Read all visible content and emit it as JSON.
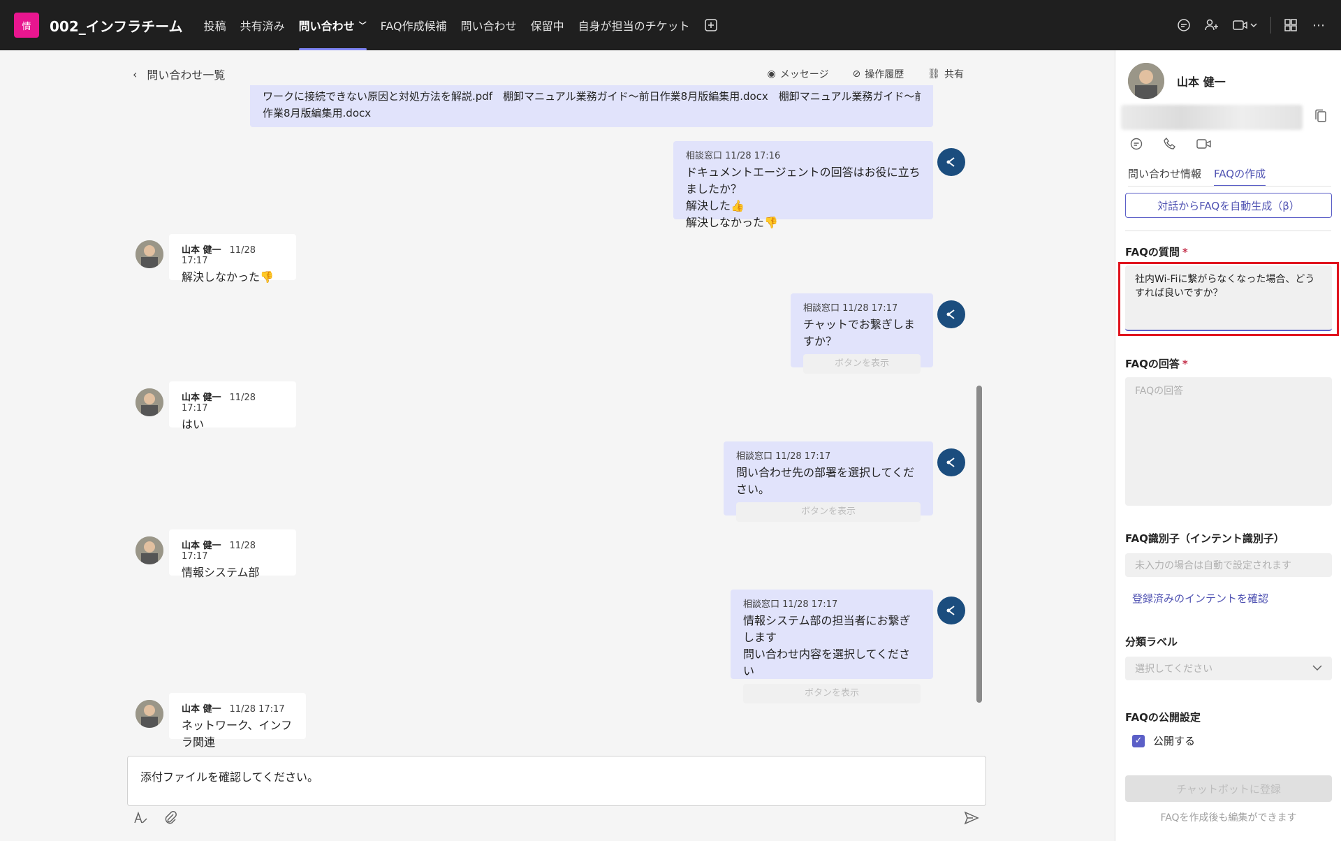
{
  "topbar": {
    "team_icon": "情",
    "team_name": "002_インフラチーム",
    "tabs": [
      {
        "label": "投稿"
      },
      {
        "label": "共有済み"
      },
      {
        "label": "問い合わせ"
      },
      {
        "label": "FAQ作成候補"
      },
      {
        "label": "問い合わせ"
      },
      {
        "label": "保留中"
      },
      {
        "label": "自身が担当のチケット"
      }
    ],
    "active_tab_index": 2,
    "right_icons": [
      "chat-icon",
      "people-add-icon",
      "video-icon",
      "apps-icon",
      "more-icon"
    ]
  },
  "chat": {
    "back_label": "問い合わせ一覧",
    "actions": {
      "message": "メッセージ",
      "history": "操作履歴",
      "share": "共有"
    },
    "attachment_text_1": "ワークに接続できない原因と対処方法を解説.pdf　棚卸マニュアル業務ガイド～前日作業8月版編集用.docx　棚卸マニュアル業務ガイド～前日",
    "attachment_text_2": "作業8月版編集用.docx",
    "messages": [
      {
        "sender": "相談窓口",
        "time": "11/28 17:16",
        "lines": [
          "ドキュメントエージェントの回答はお役に立ちましたか？",
          "解決した👍",
          "解決しなかった👎"
        ]
      },
      {
        "sender": "山本 健一",
        "time": "11/28 17:17",
        "lines": [
          "解決しなかった👎"
        ]
      },
      {
        "sender": "相談窓口",
        "time": "11/28 17:17",
        "lines": [
          "チャットでお繋ぎしますか？"
        ],
        "button": "ボタンを表示"
      },
      {
        "sender": "山本 健一",
        "time": "11/28 17:17",
        "lines": [
          "はい"
        ]
      },
      {
        "sender": "相談窓口",
        "time": "11/28 17:17",
        "lines": [
          "問い合わせ先の部署を選択してください。"
        ],
        "button": "ボタンを表示"
      },
      {
        "sender": "山本 健一",
        "time": "11/28 17:17",
        "lines": [
          "情報システム部"
        ]
      },
      {
        "sender": "相談窓口",
        "time": "11/28 17:17",
        "lines": [
          "情報システム部の担当者にお繋ぎします",
          "問い合わせ内容を選択してください"
        ],
        "button": "ボタンを表示"
      },
      {
        "sender": "山本 健一",
        "time": "11/28 17:17",
        "lines": [
          "ネットワーク、インフラ関連"
        ]
      }
    ],
    "compose_text": "添付ファイルを確認してください。"
  },
  "panel": {
    "user_name": "山本 健一",
    "tabs": [
      "問い合わせ情報",
      "FAQの作成"
    ],
    "active_tab_index": 1,
    "auto_generate_label": "対話からFAQを自動生成（β）",
    "faq_question_label": "FAQの質問",
    "faq_question_value": "社内Wi-Fiに繋がらなくなった場合、どうすれば良いですか？",
    "faq_answer_label": "FAQの回答",
    "faq_answer_placeholder": "FAQの回答",
    "intent_label": "FAQ識別子（インテント識別子）",
    "intent_placeholder": "未入力の場合は自動で設定されます",
    "intent_link": "登録済みのインテントを確認",
    "category_label": "分類ラベル",
    "category_placeholder": "選択してください",
    "publish_label": "FAQの公開設定",
    "publish_checkbox_label": "公開する",
    "register_button": "チャットボットに登録",
    "footnote": "FAQを作成後も編集ができます",
    "required_mark": "*"
  },
  "colors": {
    "accent": "#5b5fc7",
    "bot_bubble": "#e1e3fb",
    "topbar": "#1f1f1f",
    "highlight": "#e0141e",
    "team_icon": "#e8168f"
  }
}
